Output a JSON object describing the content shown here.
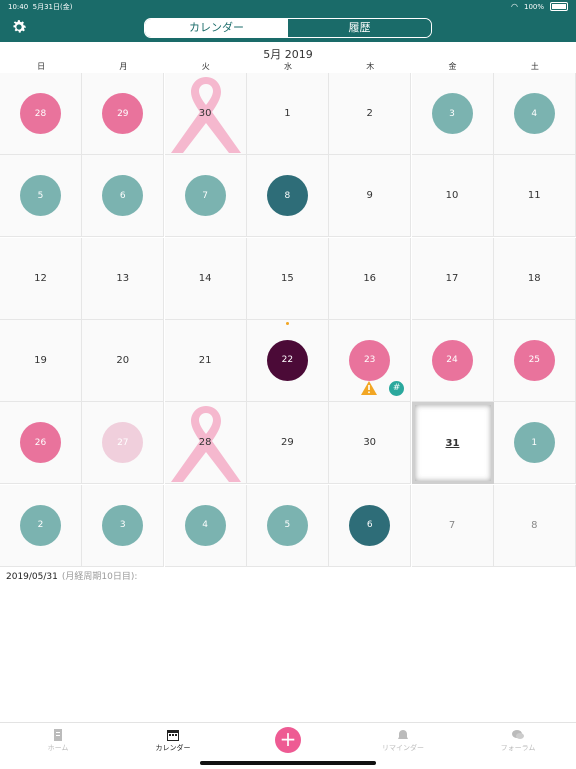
{
  "status": {
    "time": "10:40",
    "date": "5月31日(金)",
    "battery": "100%"
  },
  "header": {
    "tabs": [
      {
        "label": "カレンダー",
        "active": true
      },
      {
        "label": "履歴",
        "active": false
      }
    ]
  },
  "calendar": {
    "month_title": "5月 2019",
    "weekdays": [
      "日",
      "月",
      "火",
      "水",
      "木",
      "金",
      "土"
    ],
    "weeks": [
      [
        {
          "d": "28",
          "style": "pink"
        },
        {
          "d": "29",
          "style": "pink"
        },
        {
          "d": "30",
          "style": "ribbon"
        },
        {
          "d": "1",
          "style": "plain"
        },
        {
          "d": "2",
          "style": "plain"
        },
        {
          "d": "3",
          "style": "teal"
        },
        {
          "d": "4",
          "style": "teal"
        }
      ],
      [
        {
          "d": "5",
          "style": "teal"
        },
        {
          "d": "6",
          "style": "teal"
        },
        {
          "d": "7",
          "style": "teal"
        },
        {
          "d": "8",
          "style": "darkteal"
        },
        {
          "d": "9",
          "style": "plain"
        },
        {
          "d": "10",
          "style": "plain"
        },
        {
          "d": "11",
          "style": "plain"
        }
      ],
      [
        {
          "d": "12",
          "style": "plain"
        },
        {
          "d": "13",
          "style": "plain"
        },
        {
          "d": "14",
          "style": "plain"
        },
        {
          "d": "15",
          "style": "plain"
        },
        {
          "d": "16",
          "style": "plain"
        },
        {
          "d": "17",
          "style": "plain"
        },
        {
          "d": "18",
          "style": "plain"
        }
      ],
      [
        {
          "d": "19",
          "style": "plain"
        },
        {
          "d": "20",
          "style": "plain"
        },
        {
          "d": "21",
          "style": "plain"
        },
        {
          "d": "22",
          "style": "purple",
          "dot": true
        },
        {
          "d": "23",
          "style": "pink",
          "badges": true
        },
        {
          "d": "24",
          "style": "pink"
        },
        {
          "d": "25",
          "style": "pink"
        }
      ],
      [
        {
          "d": "26",
          "style": "pink"
        },
        {
          "d": "27",
          "style": "lightpink"
        },
        {
          "d": "28",
          "style": "ribbon"
        },
        {
          "d": "29",
          "style": "plain"
        },
        {
          "d": "30",
          "style": "plain"
        },
        {
          "d": "31",
          "style": "today"
        },
        {
          "d": "1",
          "style": "teal"
        }
      ],
      [
        {
          "d": "2",
          "style": "teal"
        },
        {
          "d": "3",
          "style": "teal"
        },
        {
          "d": "4",
          "style": "teal"
        },
        {
          "d": "5",
          "style": "teal"
        },
        {
          "d": "6",
          "style": "darkteal"
        },
        {
          "d": "7",
          "style": "dim"
        },
        {
          "d": "8",
          "style": "dim"
        }
      ]
    ],
    "badge_hash": "#"
  },
  "selected": {
    "date": "2019/05/31",
    "note": "(月経周期10日目):"
  },
  "tabbar": {
    "items": [
      {
        "label": "ホーム",
        "icon": "document-icon",
        "active": false
      },
      {
        "label": "カレンダー",
        "icon": "calendar-icon",
        "active": true
      },
      {
        "label": "",
        "icon": "plus-icon",
        "active": false
      },
      {
        "label": "リマインダー",
        "icon": "bell-icon",
        "active": false
      },
      {
        "label": "フォーラム",
        "icon": "chat-icon",
        "active": false
      }
    ],
    "add_symbol": "+"
  },
  "colors": {
    "header": "#1a6b69",
    "pink": "#e9739c",
    "teal": "#7bb3b0",
    "darkteal": "#2e6d78",
    "purple": "#4b0a37",
    "ribbon": "#f5b8ce",
    "add_button": "#ee5b93"
  }
}
